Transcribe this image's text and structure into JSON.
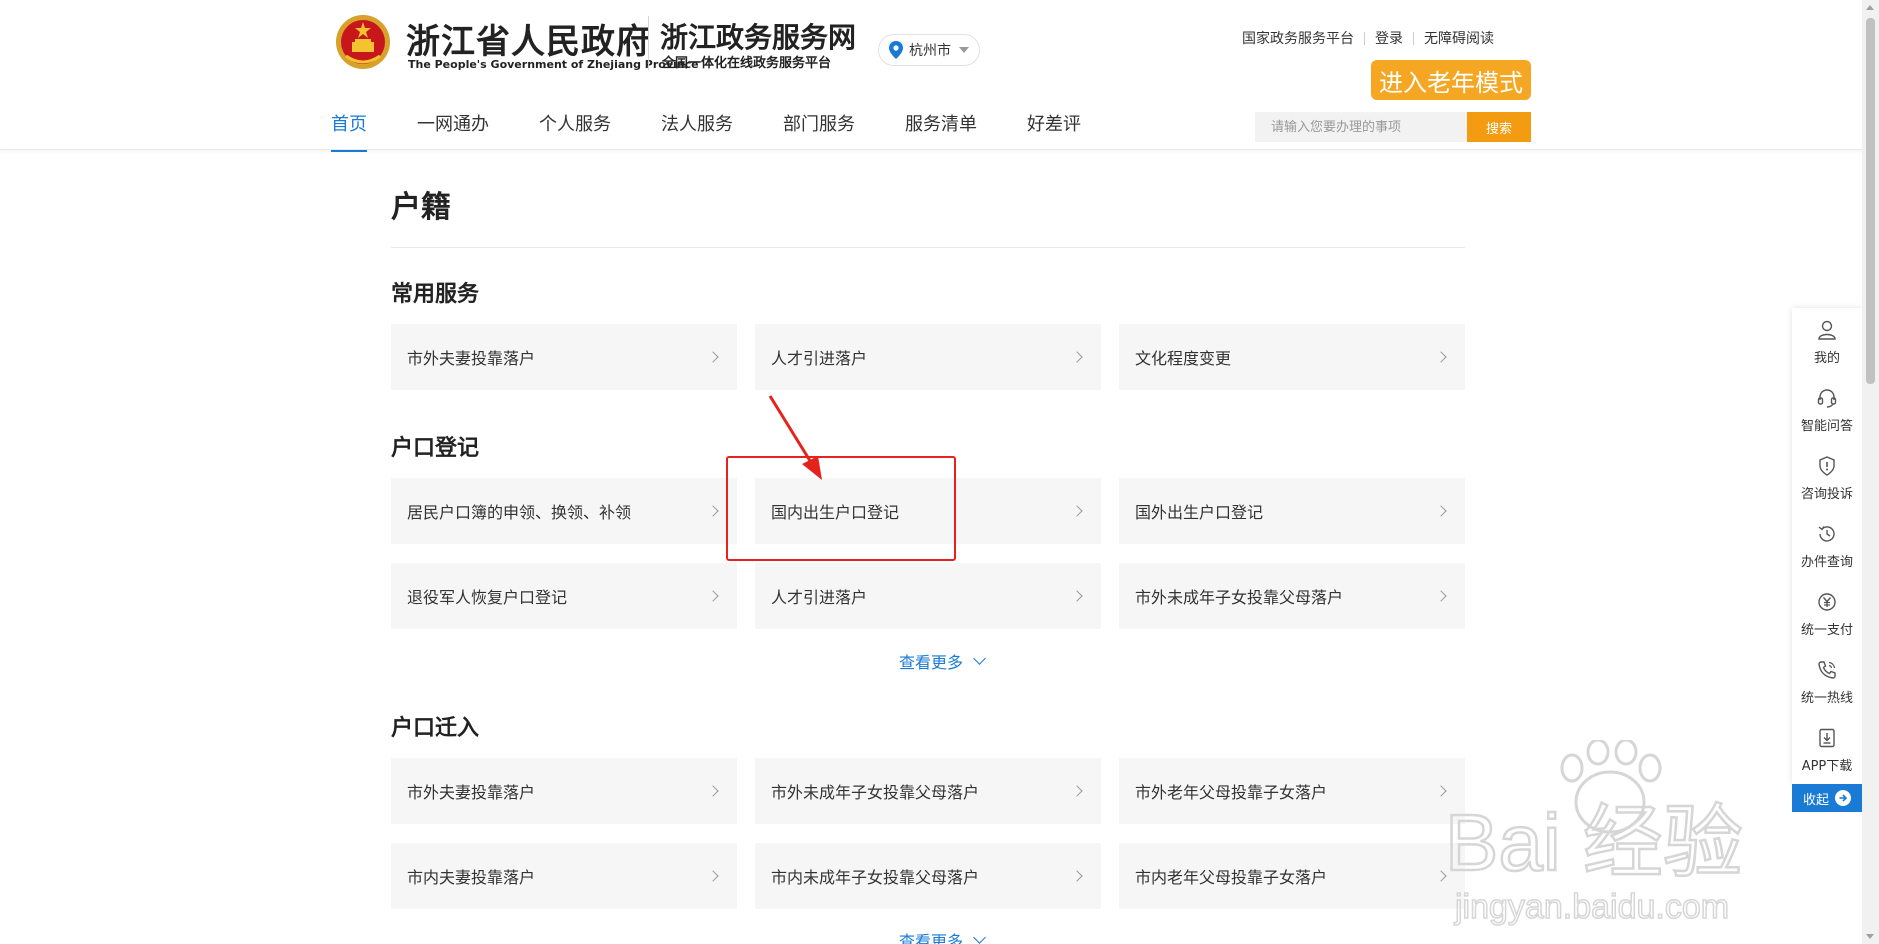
{
  "header": {
    "gov_name": "浙江省人民政府",
    "gov_name_en": "The People's Government of Zhejiang Province",
    "site_name": "浙江政务服务网",
    "site_subtitle": "全国一体化在线政务服务平台",
    "city": "杭州市",
    "top_links": [
      "国家政务服务平台",
      "登录",
      "无障碍阅读"
    ],
    "elder_mode": "进入老年模式",
    "nav": [
      "首页",
      "一网通办",
      "个人服务",
      "法人服务",
      "部门服务",
      "服务清单",
      "好差评"
    ],
    "search_placeholder": "请输入您要办理的事项",
    "search_button": "搜索"
  },
  "main": {
    "title": "户籍",
    "sections": [
      {
        "title": "常用服务",
        "items": [
          "市外夫妻投靠落户",
          "人才引进落户",
          "文化程度变更"
        ]
      },
      {
        "title": "户口登记",
        "items": [
          "居民户口簿的申领、换领、补领",
          "国内出生户口登记",
          "国外出生户口登记",
          "退役军人恢复户口登记",
          "人才引进落户",
          "市外未成年子女投靠父母落户"
        ],
        "more": "查看更多"
      },
      {
        "title": "户口迁入",
        "items": [
          "市外夫妻投靠落户",
          "市外未成年子女投靠父母落户",
          "市外老年父母投靠子女落户",
          "市内夫妻投靠落户",
          "市内未成年子女投靠父母落户",
          "市内老年父母投靠子女落户"
        ],
        "more": "查看更多"
      }
    ]
  },
  "sidebar": {
    "items": [
      "我的",
      "智能问答",
      "咨询投诉",
      "办件查询",
      "统一支付",
      "统一热线",
      "APP下载"
    ],
    "collapse": "收起"
  },
  "watermark": {
    "line1": "Bai 经验",
    "line2": "jingyan.baidu.com"
  },
  "colors": {
    "accent": "#1a7bd6",
    "orange": "#f5a623",
    "highlight": "#e5231c"
  }
}
